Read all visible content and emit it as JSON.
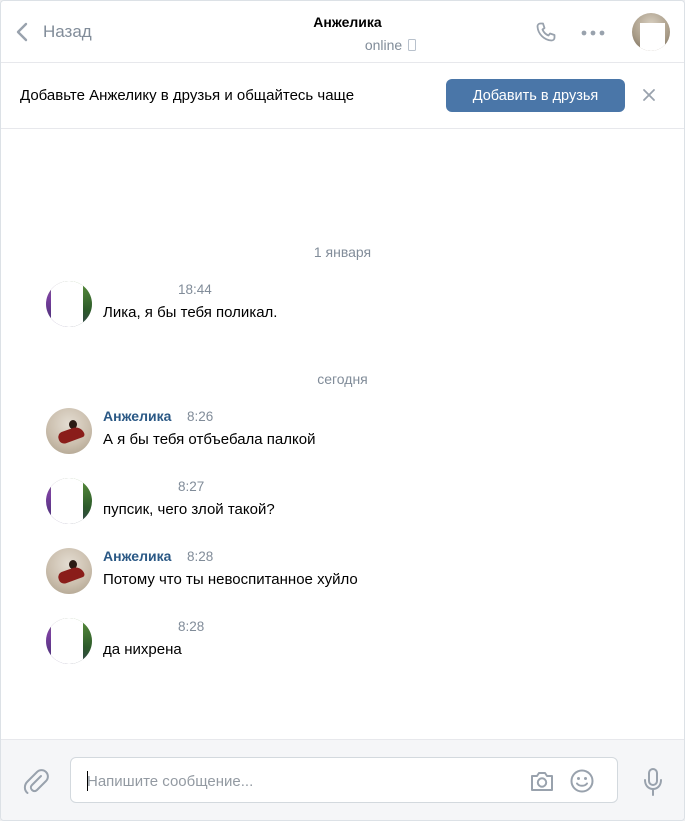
{
  "header": {
    "back_label": "Назад",
    "peer_name": "Анжелика",
    "peer_status": "online"
  },
  "banner": {
    "text": "Добавьте Анжелику в друзья и общайтесь чаще",
    "button_label": "Добавить в друзья"
  },
  "history": {
    "date_separators": [
      "1 января",
      "сегодня"
    ],
    "messages": [
      {
        "author": "",
        "time": "18:44",
        "text": "Лика, я бы тебя поликал."
      },
      {
        "author": "Анжелика",
        "time": "8:26",
        "text": "А я бы тебя отбъебала палкой"
      },
      {
        "author": "",
        "time": "8:27",
        "text": "пупсик, чего злой такой?"
      },
      {
        "author": "Анжелика",
        "time": "8:28",
        "text": "Потому что ты невоспитанное хуйло"
      },
      {
        "author": "",
        "time": "8:28",
        "text": "да нихрена"
      }
    ]
  },
  "composer": {
    "placeholder": "Напишите сообщение..."
  },
  "colors": {
    "accent": "#4a76a8",
    "author_link": "#2a5885",
    "muted": "#818c99"
  },
  "icons": [
    "chevron-left-icon",
    "phone-icon",
    "more-icon",
    "close-icon",
    "paperclip-icon",
    "camera-icon",
    "smile-icon",
    "microphone-icon"
  ]
}
